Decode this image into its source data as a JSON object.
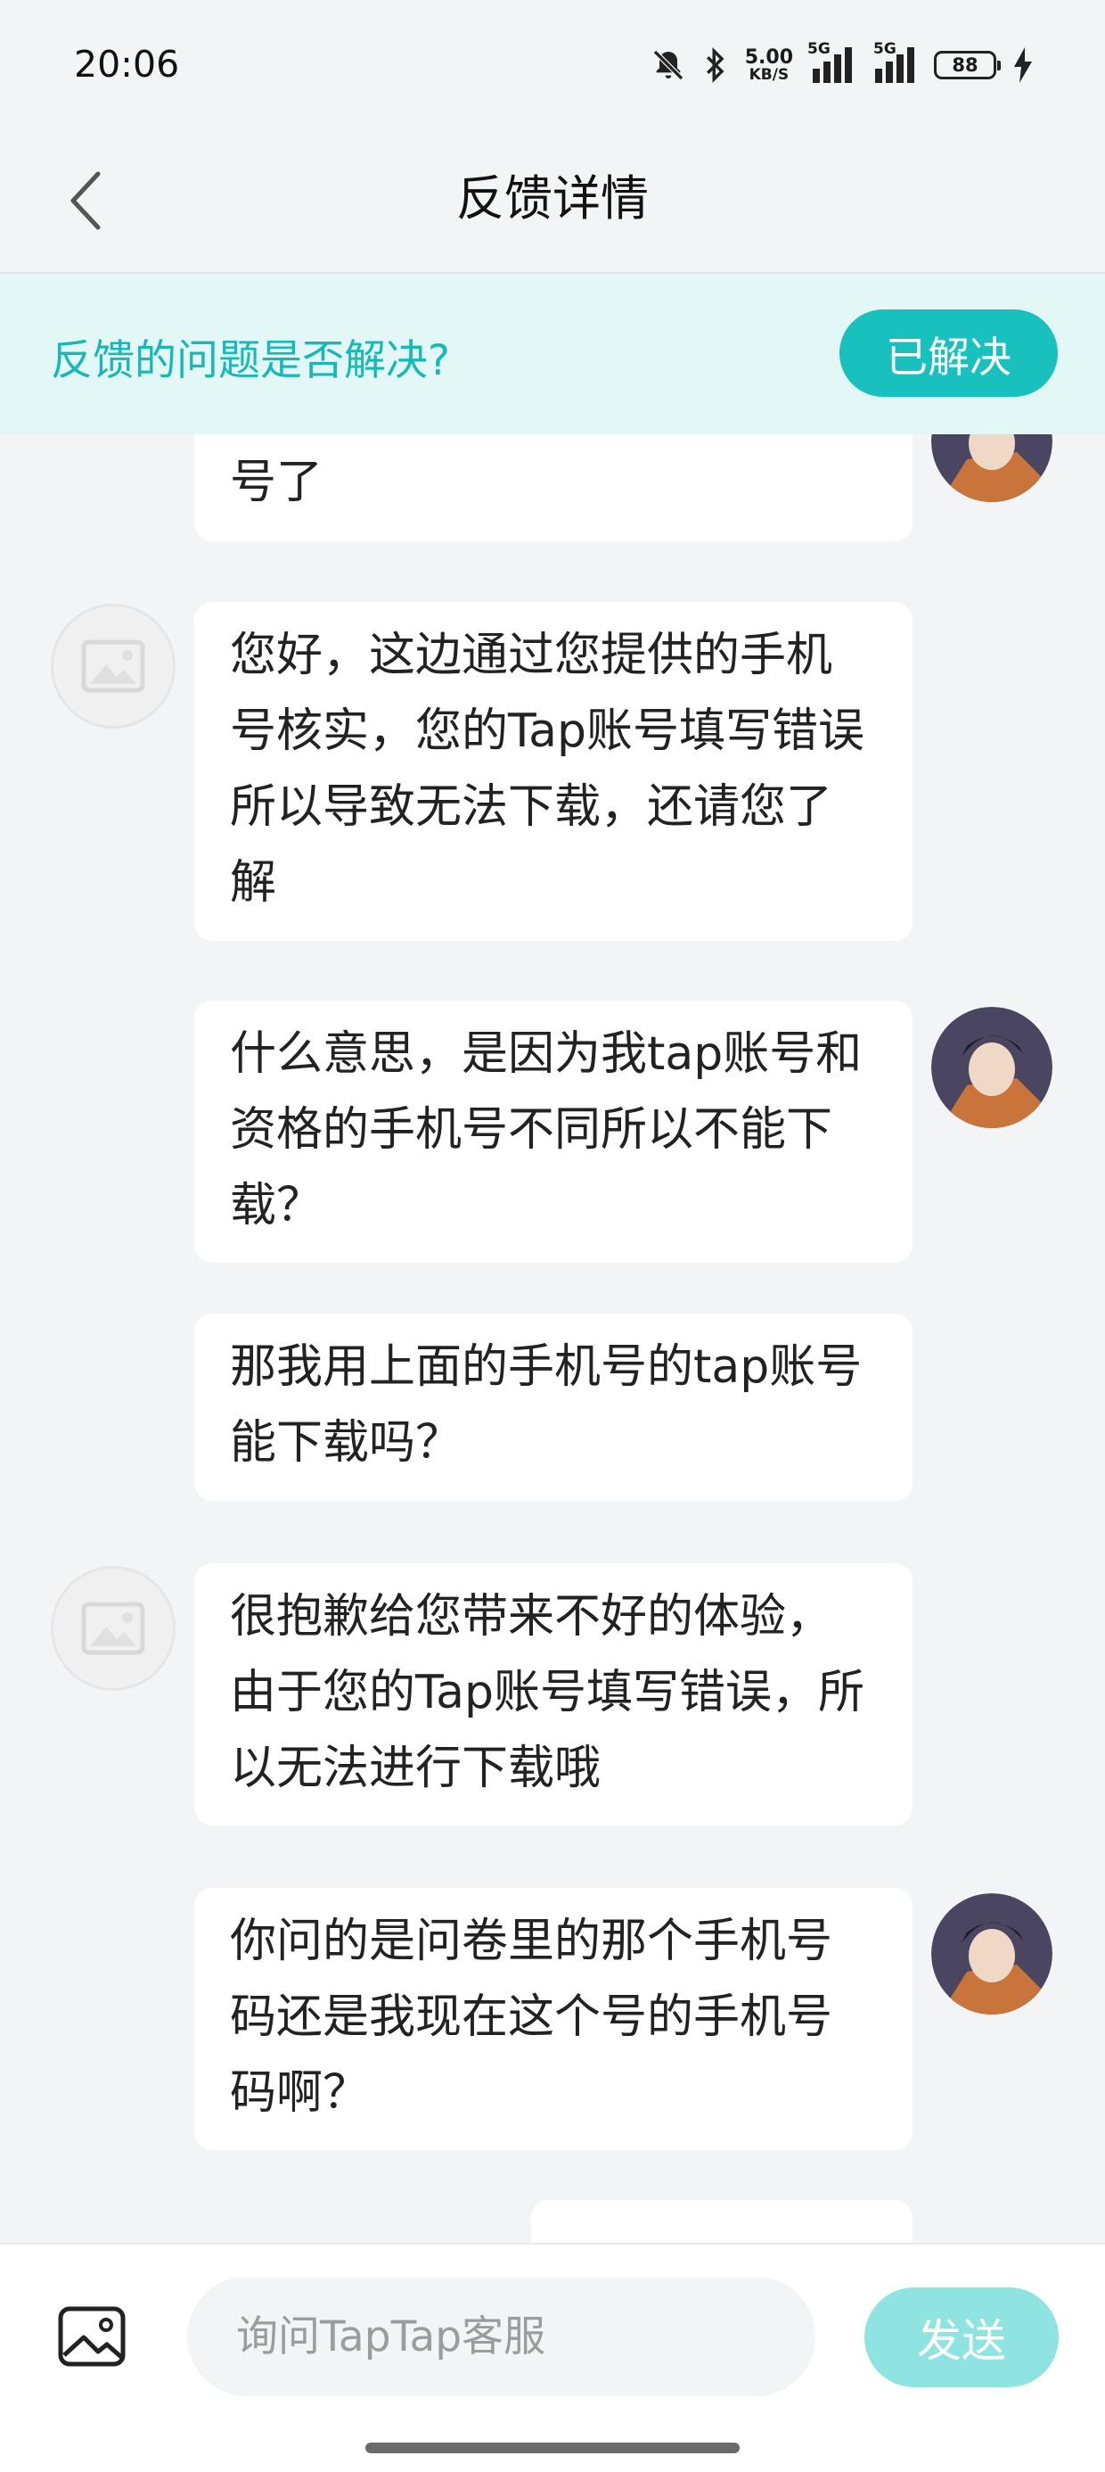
{
  "status_bar": {
    "time": "20:06",
    "net_speed_value": "5.00",
    "net_speed_unit": "KB/S",
    "signal_1_label": "5G",
    "signal_2_label": "5G",
    "battery_level": "88",
    "icons": [
      "mute-bell-icon",
      "bluetooth-icon",
      "signal-icon",
      "battery-icon",
      "charging-icon"
    ]
  },
  "header": {
    "title": "反馈详情",
    "back_icon": "chevron-left-icon"
  },
  "resolve_banner": {
    "question": "反馈的问题是否解决?",
    "button_label": "已解决",
    "accent_color": "#18c1bd"
  },
  "messages": [
    {
      "sender": "user",
      "text": "号了"
    },
    {
      "sender": "agent",
      "text": "您好，这边通过您提供的手机号核实，您的Tap账号填写错误所以导致无法下载，还请您了解"
    },
    {
      "sender": "user",
      "text": "什么意思，是因为我tap账号和资格的手机号不同所以不能下载？"
    },
    {
      "sender": "user",
      "text": "那我用上面的手机号的tap账号能下载吗？"
    },
    {
      "sender": "agent",
      "text": "很抱歉给您带来不好的体验，由于您的Tap账号填写错误，所以无法进行下载哦"
    },
    {
      "sender": "user",
      "text": "你问的是问卷里的那个手机号码还是我现在这个号的手机号码啊？"
    }
  ],
  "input_bar": {
    "placeholder": "询问TapTap客服",
    "send_label": "发送",
    "image_icon": "image-icon"
  }
}
